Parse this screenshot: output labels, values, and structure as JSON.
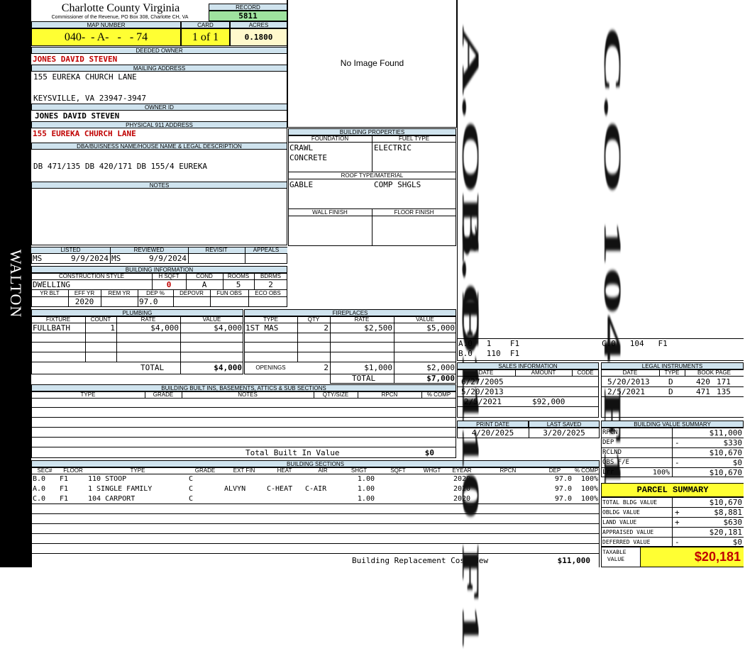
{
  "sidebar": {
    "label": "WALTON"
  },
  "header": {
    "county": "Charlotte County Virginia",
    "commissioner": "Commissioner of the Revenue, PO Box 308, Charlotte CH, VA",
    "record_label": "RECORD",
    "record": "5811",
    "map_label": "MAP NUMBER",
    "map_number": "040-  - A-   -   - 74",
    "card_label": "CARD",
    "card": "1 of 1",
    "acres_label": "ACRES",
    "acres": "0.1800"
  },
  "owner": {
    "deeded_label": "DEEDED OWNER",
    "deeded": "JONES DAVID STEVEN",
    "mailing_label": "MAILING ADDRESS",
    "mailing_line1": "155 EUREKA CHURCH LANE",
    "mailing_line2": "KEYSVILLE, VA 23947-3947",
    "owner_id_label": "OWNER ID",
    "owner_id": "JONES DAVID STEVEN",
    "physical_label": "PHYSICAL 911 ADDRESS",
    "physical": "155 EUREKA CHURCH LANE",
    "dba_label": "DBA/BUISNESS NAME/HOUSE NAME & LEGAL DESCRIPTION",
    "dba": "DB 471/135 DB 420/171 DB 155/4 EUREKA",
    "notes_label": "NOTES"
  },
  "image": {
    "no_image": "No Image Found"
  },
  "review": {
    "listed_label": "LISTED",
    "reviewed_label": "REVIEWED",
    "revisit_label": "REVISIT",
    "appeals_label": "APPEALS",
    "listed_by": "MS",
    "listed_date": "9/9/2024",
    "reviewed_by": "MS",
    "reviewed_date": "9/9/2024"
  },
  "building_info": {
    "title": "BUILDING INFORMATION",
    "h_style": "CONSTRUCTION STYLE",
    "h_hsqft": "H SQFT",
    "h_cond": "COND",
    "h_rooms": "ROOMS",
    "h_bdrms": "BDRMS",
    "style": "DWELLING",
    "hsqft": "0",
    "cond": "A",
    "rooms": "5",
    "bdrms": "2",
    "h_yrblt": "YR BLT",
    "h_effyr": "EFF YR",
    "h_remyr": "REM YR",
    "h_dep": "DEP %",
    "h_depovr": "DEPOVR",
    "h_funobs": "FUN OBS",
    "h_ecoobs": "ECO OBS",
    "effyr": "2020",
    "dep": "97.0"
  },
  "properties": {
    "title": "BUILDING PROPERTIES",
    "foundation_label": "FOUNDATION",
    "fuel_label": "FUEL TYPE",
    "foundation1": "CRAWL",
    "foundation2": "CONCRETE",
    "fuel": "ELECTRIC",
    "roof_label": "ROOF TYPE/MATERIAL",
    "roof_type": "GABLE",
    "roof_material": "COMP SHGLS",
    "wall_label": "WALL FINISH",
    "floor_label": "FLOOR FINISH"
  },
  "plumbing": {
    "title": "PLUMBING",
    "h_fixture": "FIXTURE",
    "h_count": "COUNT",
    "h_rate": "RATE",
    "h_value": "VALUE",
    "rows": [
      {
        "fixture": "FULLBATH",
        "count": "1",
        "rate": "$4,000",
        "value": "$4,000"
      }
    ],
    "total_label": "TOTAL",
    "total": "$4,000"
  },
  "fireplaces": {
    "title": "FIREPLACES",
    "h_type": "TYPE",
    "h_qty": "QTY",
    "h_rate": "RATE",
    "h_value": "VALUE",
    "rows": [
      {
        "type": "1ST MAS",
        "qty": "2",
        "rate": "$2,500",
        "value": "$5,000"
      }
    ],
    "openings_label": "OPENINGS",
    "openings_qty": "2",
    "openings_rate": "$1,000",
    "openings_value": "$2,000",
    "total_label": "TOTAL",
    "total": "$7,000"
  },
  "builtins": {
    "title": "BUILDING BUILT INS, BASEMENTS, ATTICS & SUB SECTIONS",
    "h_type": "TYPE",
    "h_grade": "GRADE",
    "h_notes": "NOTES",
    "h_qty": "QTY/SIZE",
    "h_rpcn": "RPCN",
    "h_pcomp": "% COMP",
    "total_label": "Total Built In Value",
    "total": "$0"
  },
  "sections": {
    "title": "BUILDING SECTIONS",
    "headers": [
      "SEC#",
      "FLOOR",
      "TYPE",
      "GRADE",
      "EXT FIN",
      "HEAT",
      "AIR",
      "SHGT",
      "SQFT",
      "WHGT",
      "EYEAR",
      "RPCN",
      "DEP",
      "% COMP"
    ],
    "rows": [
      {
        "sec": "B.0",
        "floor": "F1",
        "type": "110 STOOP",
        "grade": "C",
        "extfin": "",
        "heat": "",
        "air": "",
        "shgt": "1.00",
        "eyear": "2020",
        "dep": "97.0",
        "pcomp": "100%"
      },
      {
        "sec": "A.0",
        "floor": "F1",
        "type": "1 SINGLE FAMILY",
        "grade": "C",
        "extfin": "ALVYN",
        "heat": "C-HEAT",
        "air": "C-AIR",
        "shgt": "1.00",
        "eyear": "2020",
        "dep": "97.0",
        "pcomp": "100%"
      },
      {
        "sec": "C.0",
        "floor": "F1",
        "type": "104 CARPORT",
        "grade": "C",
        "extfin": "",
        "heat": "",
        "air": "",
        "shgt": "1.00",
        "eyear": "2020",
        "dep": "97.0",
        "pcomp": "100%"
      }
    ],
    "replacement_label": "Building Replacement Cost New",
    "replacement": "$11,000"
  },
  "sketch": {
    "labels": [
      {
        "text": "A.O  1   F1"
      },
      {
        "text": "C.O  104  F1"
      },
      {
        "text": "B.O  110  F1"
      }
    ],
    "legend": [
      {
        "a": "A.0   1    F1",
        "b": "C.0   104   F1"
      },
      {
        "a": "B.0   110  F1",
        "b": ""
      }
    ]
  },
  "sales": {
    "title": "SALES INFORMATION",
    "h_date": "DATE",
    "h_amount": "AMOUNT",
    "h_code": "CODE",
    "rows": [
      {
        "date": "6/27/2005",
        "amount": ""
      },
      {
        "date": "5/20/2013",
        "amount": ""
      },
      {
        "date": "2/5/2021",
        "amount": "$92,000"
      }
    ]
  },
  "legal": {
    "title": "LEGAL INSTRUMENTS",
    "h_date": "DATE",
    "h_type": "TYPE",
    "h_bookpage": "BOOK PAGE",
    "rows": [
      {
        "date": "5/20/2013",
        "type": "D",
        "book": "420",
        "page": "171"
      },
      {
        "date": "2/5/2021",
        "type": "D",
        "book": "471",
        "page": "135"
      }
    ]
  },
  "print": {
    "print_label": "PRINT DATE",
    "print_date": "4/20/2025",
    "saved_label": "LAST SAVED",
    "saved_date": "3/20/2025"
  },
  "value_summary": {
    "title": "BUILDING VALUE SUMMARY",
    "rows": [
      {
        "label": "RPCN",
        "sign": "",
        "value": "$11,000"
      },
      {
        "label": "DEP",
        "sign": "-",
        "value": "$330"
      },
      {
        "label": "RCLND",
        "sign": "",
        "value": "$10,670"
      },
      {
        "label": "OBS F/E",
        "sign": "-",
        "value": "$0"
      },
      {
        "label": "Lrr",
        "pct": "100%",
        "sign": "",
        "value": "$10,670"
      }
    ]
  },
  "parcel": {
    "title": "PARCEL SUMMARY",
    "rows": [
      {
        "label": "TOTAL BLDG VALUE",
        "sign": "",
        "value": "$10,670"
      },
      {
        "label": "OBLDG VALUE",
        "sign": "+",
        "value": "$8,881"
      },
      {
        "label": "LAND VALUE",
        "sign": "+",
        "value": "$630"
      },
      {
        "label": "APPRAISED VALUE",
        "sign": "",
        "value": "$20,181"
      },
      {
        "label": "DEFERRED VALUE",
        "sign": "-",
        "value": "$0"
      }
    ],
    "taxable_label1": "TAXABLE",
    "taxable_label2": "VALUE",
    "taxable": "$20,181"
  }
}
